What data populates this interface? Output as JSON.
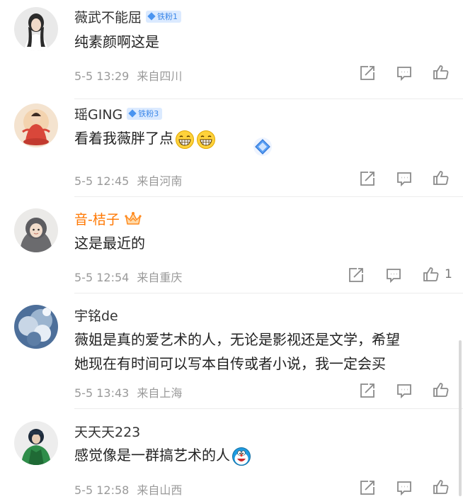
{
  "comments": [
    {
      "username": "薇武不能屈",
      "badge": "铁粉1",
      "lines": [
        "纯素颜啊这是"
      ],
      "date": "5-5 13:29",
      "location": "来自四川",
      "likes": ""
    },
    {
      "username": "瑶GING",
      "badge": "铁粉3",
      "lines": [
        "看着我薇胖了点"
      ],
      "emoji": [
        "grin-emoji",
        "grin-emoji"
      ],
      "date": "5-5 12:45",
      "location": "来自河南",
      "likes": ""
    },
    {
      "username": "音-桔子",
      "badge": "",
      "lines": [
        "这是最近的"
      ],
      "date": "5-5 12:54",
      "location": "来自重庆",
      "likes": "1"
    },
    {
      "username": "宇铭de",
      "badge": "",
      "lines": [
        "薇姐是真的爱艺术的人，无论是影视还是文学，希望",
        "她现在有时间可以写本自传或者小说，我一定会买"
      ],
      "date": "5-5 13:43",
      "location": "来自上海",
      "likes": ""
    },
    {
      "username": "天天天223",
      "badge": "",
      "lines": [
        "感觉像是一群搞艺术的人"
      ],
      "emoji": [
        "doraemon-emoji"
      ],
      "date": "5-5 12:58",
      "location": "来自山西",
      "likes": ""
    }
  ],
  "icons": {
    "share": "share-icon",
    "comment": "comment-icon",
    "like": "like-icon"
  },
  "colors": {
    "username": "#333333",
    "orange_username": "#ff7700",
    "meta": "#9a9a9a",
    "badge_bg": "#dbeaff",
    "badge_text": "#3a86e8"
  }
}
